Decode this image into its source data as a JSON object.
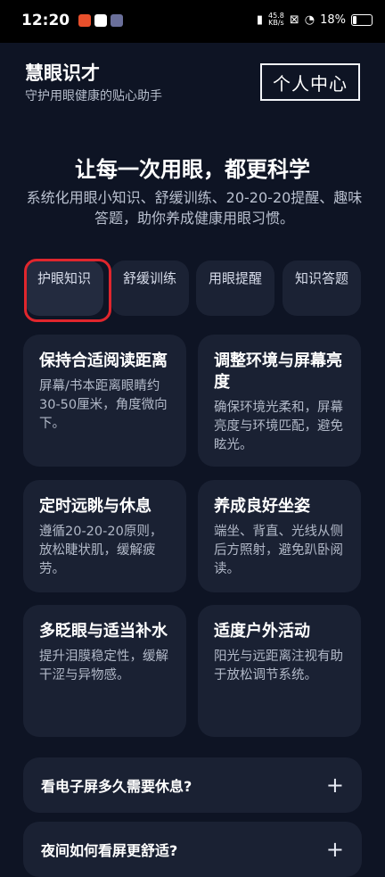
{
  "status": {
    "time": "12:20",
    "network_speed_top": "45.8",
    "network_speed_unit": "KB/s",
    "battery": "18%"
  },
  "header": {
    "title": "慧眼识才",
    "subtitle": "守护用眼健康的贴心助手",
    "profile_button": "个人中心"
  },
  "hero": {
    "title": "让每一次用眼，都更科学",
    "description": "系统化用眼小知识、舒缓训练、20-20-20提醒、趣味答题，助你养成健康用眼习惯。"
  },
  "tabs": [
    {
      "label": "护眼知识"
    },
    {
      "label": "舒缓训练"
    },
    {
      "label": "用眼提醒"
    },
    {
      "label": "知识答题"
    }
  ],
  "cards": [
    {
      "title": "保持合适阅读距离",
      "desc": "屏幕/书本距离眼睛约30-50厘米，角度微向下。"
    },
    {
      "title": "调整环境与屏幕亮度",
      "desc": "确保环境光柔和，屏幕亮度与环境匹配，避免眩光。"
    },
    {
      "title": "定时远眺与休息",
      "desc": "遵循20-20-20原则，放松睫状肌，缓解疲劳。"
    },
    {
      "title": "养成良好坐姿",
      "desc": "端坐、背直、光线从侧后方照射，避免趴卧阅读。"
    },
    {
      "title": "多眨眼与适当补水",
      "desc": "提升泪膜稳定性，缓解干涩与异物感。"
    },
    {
      "title": "适度户外活动",
      "desc": "阳光与远距离注视有助于放松调节系统。"
    }
  ],
  "faq": [
    {
      "question": "看电子屏多久需要休息?",
      "icon": "+"
    },
    {
      "question": "夜间如何看屏更舒适?",
      "icon": "+"
    }
  ],
  "colors": {
    "background": "#0e1424",
    "card": "#1a2133",
    "highlight": "#e0262d"
  }
}
